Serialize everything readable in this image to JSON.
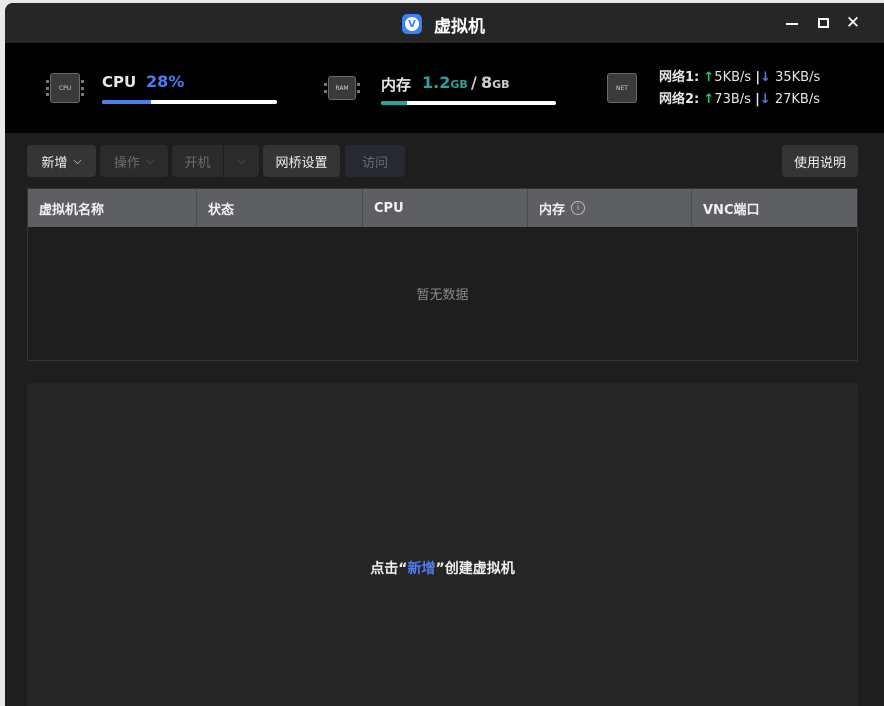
{
  "window": {
    "title": "虚拟机",
    "app_icon_letter": "V"
  },
  "controls": {
    "minimize_icon": "minimize-icon",
    "maximize_icon": "maximize-icon",
    "close_icon": "close-icon",
    "close_glyph": "✕"
  },
  "monitor": {
    "cpu": {
      "chip_text": "CPU",
      "label": "CPU",
      "value": "28%",
      "percent": 28,
      "color": "#4c7cf0"
    },
    "memory": {
      "chip_text": "RAM",
      "label": "内存",
      "used": "1.2",
      "used_unit": "GB",
      "separator": "/",
      "total": "8",
      "total_unit": "GB",
      "fraction": 0.15,
      "color": "#2aa39a"
    },
    "network": {
      "chip_text": "NET",
      "lines": [
        {
          "label": "网络1:",
          "up_arrow": "↑",
          "up": "5KB/s",
          "sep": "|",
          "down_arrow": "↓",
          "down": "35KB/s"
        },
        {
          "label": "网络2:",
          "up_arrow": "↑",
          "up": "73B/s",
          "sep": "|",
          "down_arrow": "↓",
          "down": "27KB/s"
        }
      ]
    }
  },
  "toolbar": {
    "new_label": "新增",
    "operate_label": "操作",
    "power_label": "开机",
    "chevron": "⌵",
    "bridge_label": "网桥设置",
    "visit_label": "访问",
    "help_label": "使用说明"
  },
  "table": {
    "columns": [
      "虚拟机名称",
      "状态",
      "CPU",
      "内存",
      "VNC端口"
    ],
    "info_glyph": "i",
    "empty_text": "暂无数据"
  },
  "hint": {
    "before": "点击",
    "open_quote": "“",
    "action": "新增",
    "close_quote": "”",
    "after": "创建虚拟机"
  }
}
